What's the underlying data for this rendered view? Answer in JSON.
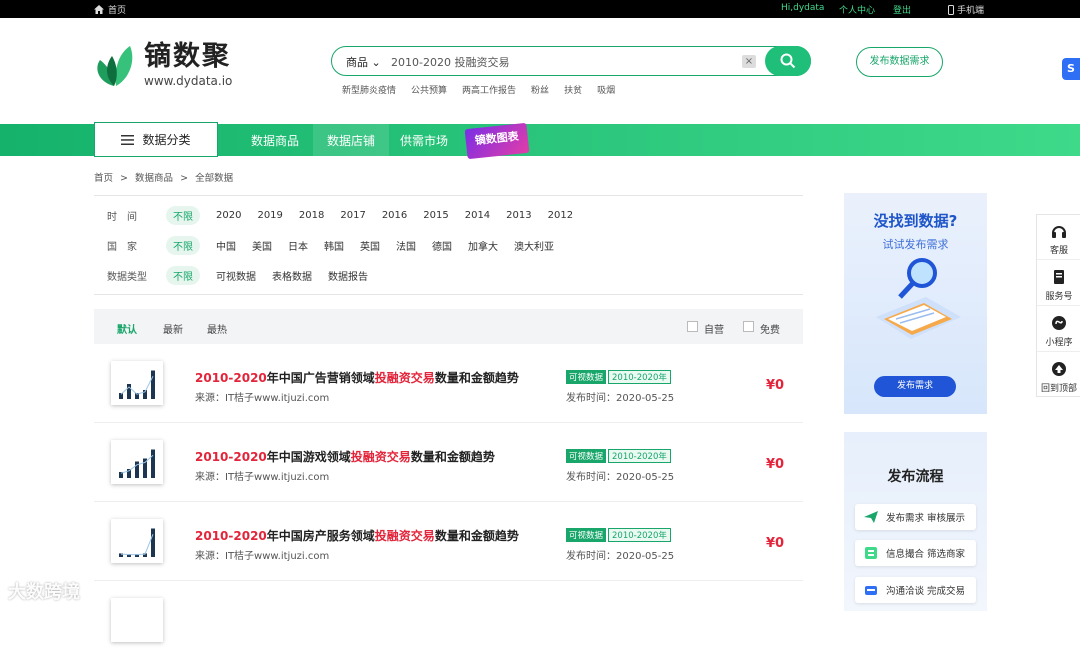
{
  "topbar": {
    "home": "首页",
    "greeting": "Hi,dydata",
    "user_center": "个人中心",
    "logout": "登出",
    "mobile": "手机端"
  },
  "logo": {
    "name": "镝数聚",
    "url": "www.dydata.io"
  },
  "search": {
    "category": "商品",
    "query": "2010-2020 投融资交易",
    "clear": "×"
  },
  "hotwords": [
    "新型肺炎疫情",
    "公共预算",
    "两高工作报告",
    "粉丝",
    "扶贫",
    "吸烟"
  ],
  "publish_button": "发布数据需求",
  "side_tab": "S",
  "nav": {
    "category_button": "数据分类",
    "items": [
      "数据商品",
      "数据店铺",
      "供需市场"
    ],
    "badge": "镝数图表"
  },
  "breadcrumb": [
    "首页",
    ">",
    "数据商品",
    ">",
    "全部数据"
  ],
  "filters": {
    "time": {
      "label": "时　间",
      "selected": "不限",
      "options": [
        "2020",
        "2019",
        "2018",
        "2017",
        "2016",
        "2015",
        "2014",
        "2013",
        "2012"
      ]
    },
    "country": {
      "label": "国　家",
      "selected": "不限",
      "options": [
        "中国",
        "美国",
        "日本",
        "韩国",
        "英国",
        "法国",
        "德国",
        "加拿大",
        "澳大利亚"
      ]
    },
    "type": {
      "label": "数据类型",
      "selected": "不限",
      "options": [
        "可视数据",
        "表格数据",
        "数据报告"
      ]
    }
  },
  "sort": {
    "default": "默认",
    "newest": "最新",
    "hottest": "最热",
    "self": "自营",
    "free": "免费"
  },
  "products": [
    {
      "title_a": "2010-2020",
      "title_b": "年中国广告营销领域",
      "title_c": "投融资交易",
      "title_d": "数量和金额趋势",
      "source": "来源：IT桔子www.itjuzi.com",
      "tag": "可视数据",
      "range": "2010-2020年",
      "pubtime": "发布时间：2020-05-25",
      "price": "¥0",
      "bars": [
        0.2,
        0.5,
        0.2,
        0.3,
        0.95
      ]
    },
    {
      "title_a": "2010-2020",
      "title_b": "年中国游戏领域",
      "title_c": "投融资交易",
      "title_d": "数量和金额趋势",
      "source": "来源：IT桔子www.itjuzi.com",
      "tag": "可视数据",
      "range": "2010-2020年",
      "pubtime": "发布时间：2020-05-25",
      "price": "¥0",
      "bars": [
        0.2,
        0.3,
        0.55,
        0.65,
        0.95
      ]
    },
    {
      "title_a": "2010-2020",
      "title_b": "年中国房产服务领域",
      "title_c": "投融资交易",
      "title_d": "数量和金额趋势",
      "source": "来源：IT桔子www.itjuzi.com",
      "tag": "可视数据",
      "range": "2010-2020年",
      "pubtime": "发布时间：2020-05-25",
      "price": "¥0",
      "bars": [
        0.12,
        0.1,
        0.1,
        0.12,
        0.95
      ]
    }
  ],
  "promo": {
    "title": "没找到数据?",
    "subtitle": "试试发布需求",
    "button": "发布需求"
  },
  "flow": {
    "title": "发布流程",
    "steps": [
      "发布需求 审核展示",
      "信息撮合 筛选商家",
      "沟通洽谈 完成交易"
    ]
  },
  "rightbar": [
    "客服",
    "服务号",
    "小程序",
    "回到顶部"
  ],
  "watermark": "大数跨境",
  "colors": {
    "brand_green": "#18a66a",
    "price_red": "#e3243a",
    "promo_blue": "#1f55d6"
  }
}
